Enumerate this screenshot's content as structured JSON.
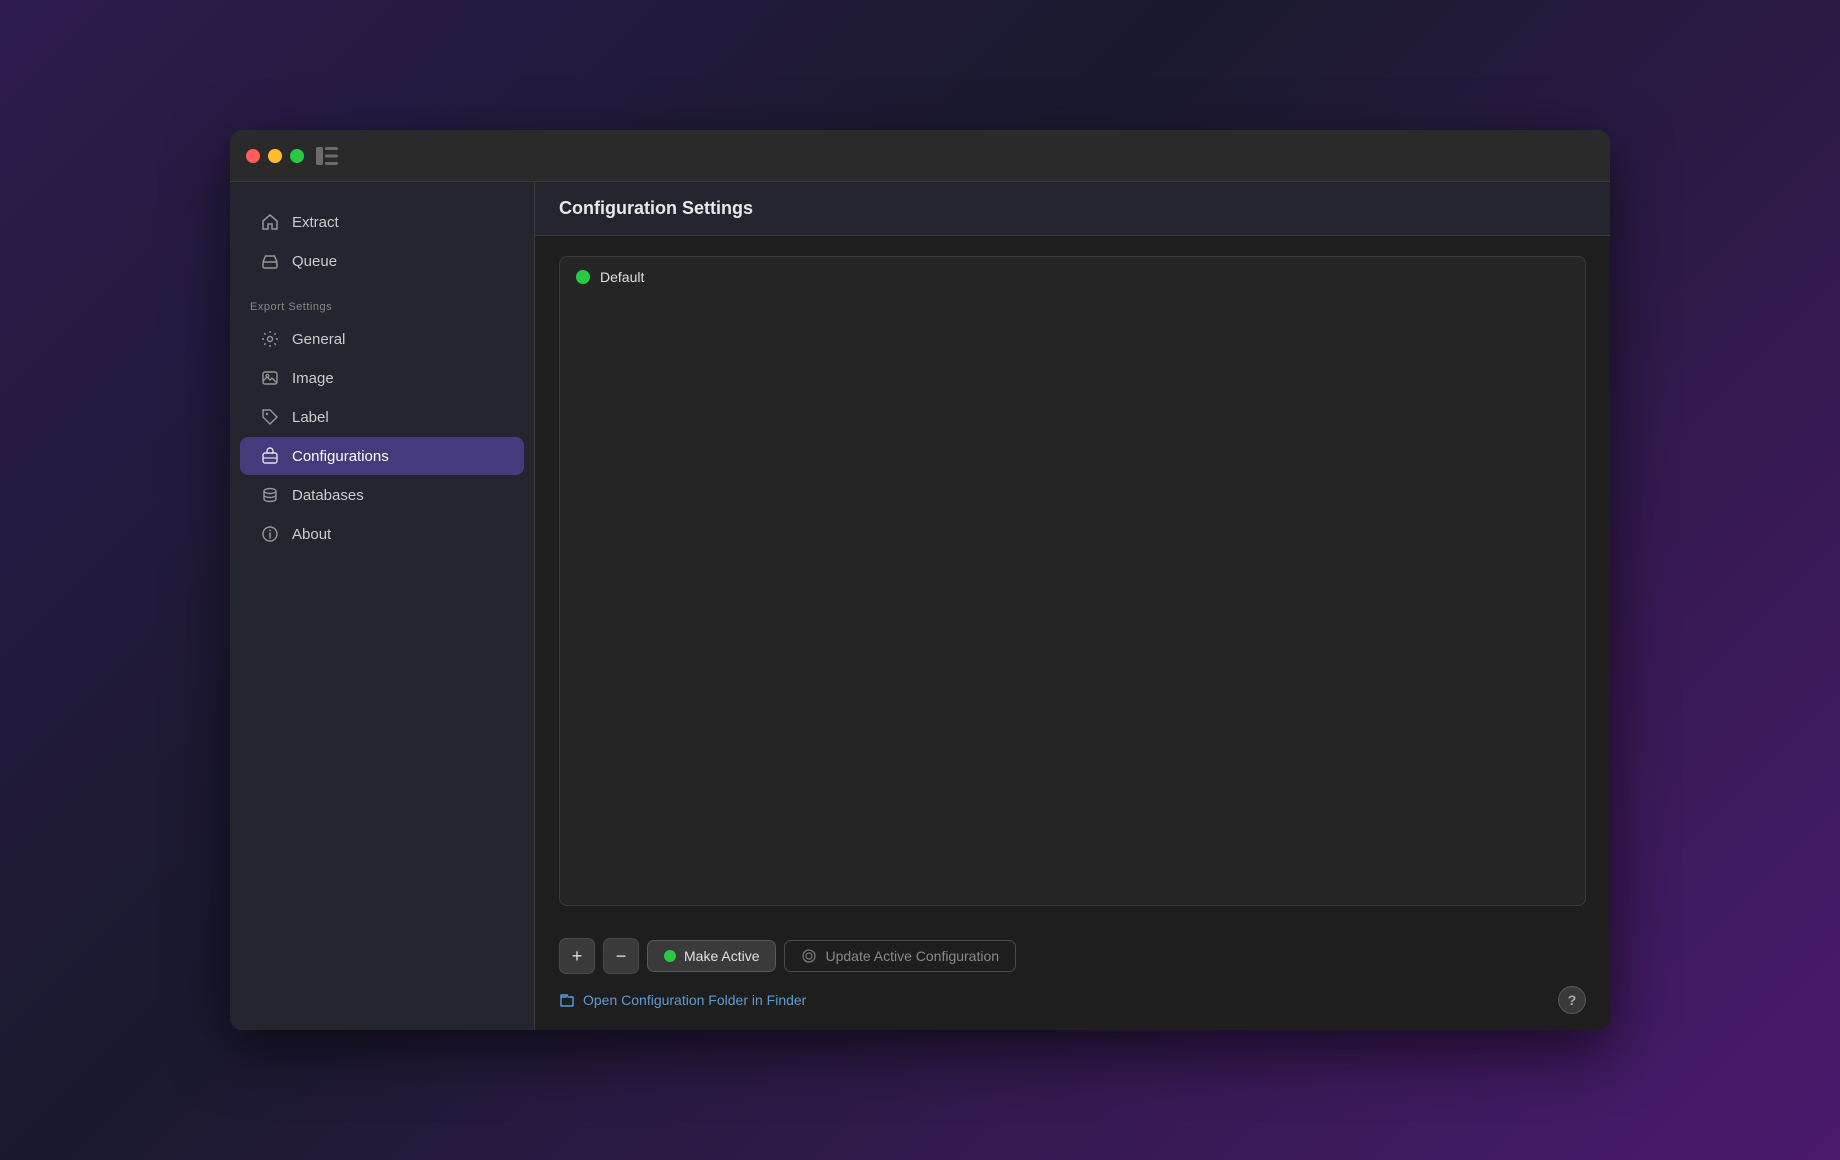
{
  "window": {
    "title": "Configuration Settings"
  },
  "traffic_lights": {
    "close_label": "close",
    "minimize_label": "minimize",
    "maximize_label": "maximize"
  },
  "sidebar": {
    "nav_items": [
      {
        "id": "extract",
        "label": "Extract",
        "icon": "house"
      },
      {
        "id": "queue",
        "label": "Queue",
        "icon": "tray"
      }
    ],
    "section_label": "Export Settings",
    "settings_items": [
      {
        "id": "general",
        "label": "General",
        "icon": "gear"
      },
      {
        "id": "image",
        "label": "Image",
        "icon": "image"
      },
      {
        "id": "label",
        "label": "Label",
        "icon": "tag"
      },
      {
        "id": "configurations",
        "label": "Configurations",
        "icon": "briefcase",
        "active": true
      },
      {
        "id": "databases",
        "label": "Databases",
        "icon": "database"
      },
      {
        "id": "about",
        "label": "About",
        "icon": "info"
      }
    ]
  },
  "content": {
    "header": "Configuration Settings",
    "config_items": [
      {
        "id": "default",
        "name": "Default",
        "status": "active"
      }
    ]
  },
  "footer": {
    "add_label": "+",
    "remove_label": "−",
    "make_active_label": "Make Active",
    "update_active_label": "Update Active Configuration",
    "open_folder_label": "Open Configuration Folder in Finder",
    "help_label": "?"
  }
}
